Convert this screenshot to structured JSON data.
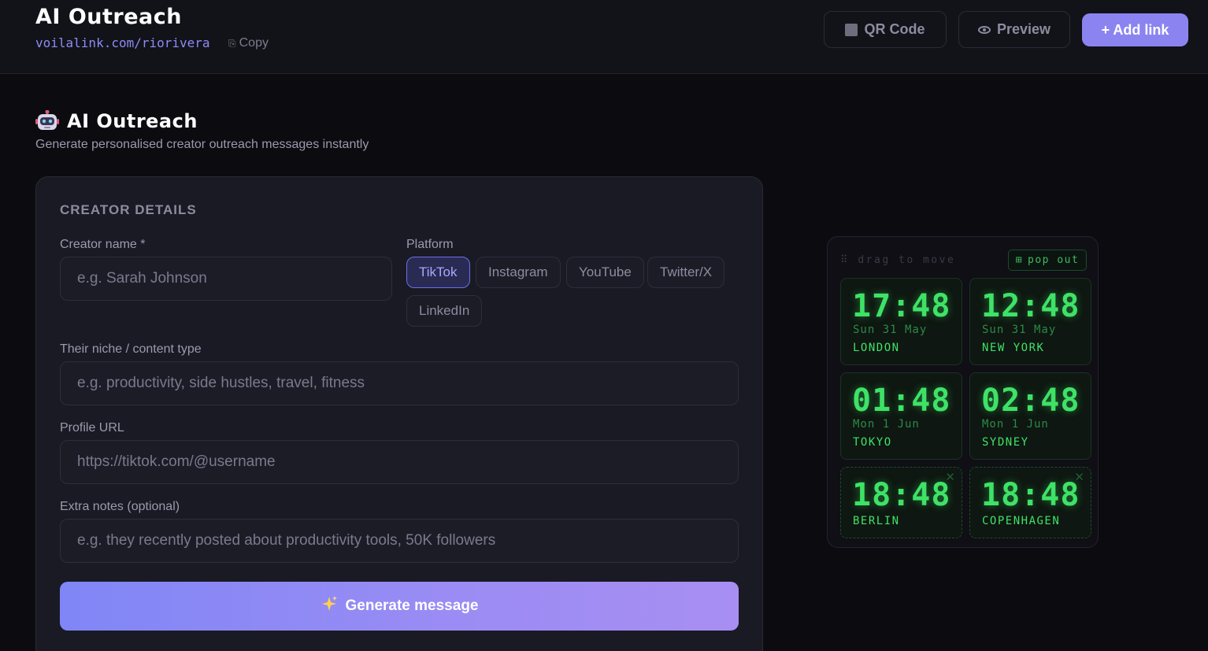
{
  "header": {
    "app_title": "AI Outreach",
    "link_url": "voilalink.com/riorivera",
    "copy_label": "Copy",
    "qr_label": "QR Code",
    "preview_label": "Preview",
    "add_link_label": "+ Add link"
  },
  "page": {
    "title": "AI Outreach",
    "subtitle": "Generate personalised creator outreach messages instantly"
  },
  "form": {
    "section_label": "CREATOR DETAILS",
    "creator_name": {
      "label": "Creator name *",
      "placeholder": "e.g. Sarah Johnson",
      "value": ""
    },
    "platform": {
      "label": "Platform",
      "options": [
        "TikTok",
        "Instagram",
        "YouTube",
        "Twitter/X",
        "LinkedIn"
      ],
      "selected": "TikTok"
    },
    "niche": {
      "label": "Their niche / content type",
      "placeholder": "e.g. productivity, side hustles, travel, fitness",
      "value": ""
    },
    "profile_url": {
      "label": "Profile URL",
      "placeholder": "https://tiktok.com/@username",
      "value": ""
    },
    "extra_notes": {
      "label": "Extra notes (optional)",
      "placeholder": "e.g. they recently posted about productivity tools, 50K followers",
      "value": ""
    },
    "generate_label": "Generate message",
    "generate_icon": "sparkles-icon"
  },
  "clock_widget": {
    "drag_hint": "drag to move",
    "popout_label": "pop out",
    "clocks": [
      {
        "time": "17:48",
        "date": "Sun 31 May",
        "city": "LONDON"
      },
      {
        "time": "12:48",
        "date": "Sun 31 May",
        "city": "NEW YORK"
      },
      {
        "time": "01:48",
        "date": "Mon 1 Jun",
        "city": "TOKYO"
      },
      {
        "time": "02:48",
        "date": "Mon 1 Jun",
        "city": "SYDNEY"
      },
      {
        "time": "18:48",
        "date": "",
        "city": "BERLIN"
      },
      {
        "time": "18:48",
        "date": "",
        "city": "COPENHAGEN"
      }
    ],
    "accent_color": "#3ee266"
  },
  "colors": {
    "brand": "#8b84f0",
    "background": "#0b0b10",
    "card": "#1a1a24"
  }
}
